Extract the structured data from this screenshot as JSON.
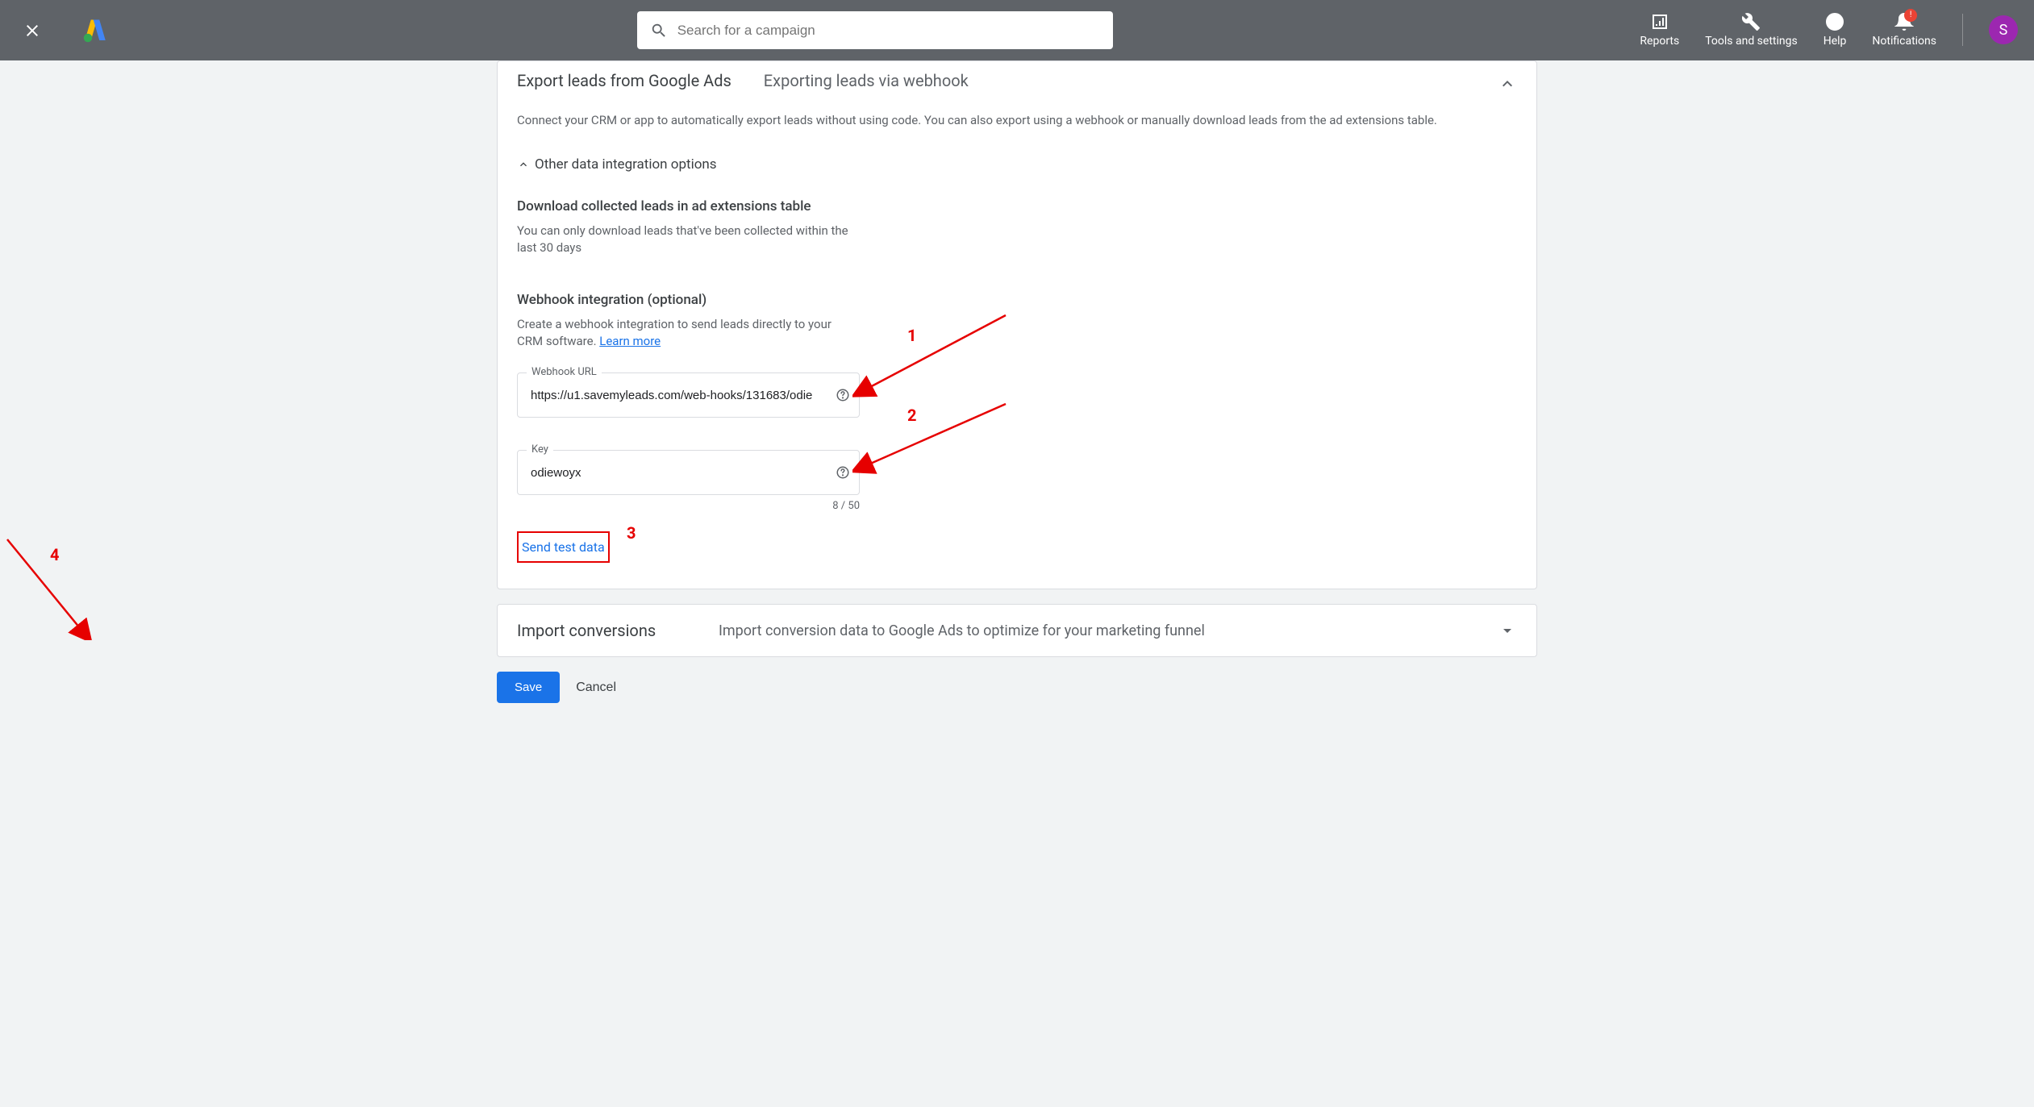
{
  "header": {
    "search_placeholder": "Search for a campaign",
    "reports_label": "Reports",
    "tools_label": "Tools and settings",
    "help_label": "Help",
    "notifications_label": "Notifications",
    "avatar_initial": "S",
    "notification_badge": "!"
  },
  "card1": {
    "breadcrumb": "Export leads from Google Ads",
    "title": "Exporting leads via webhook",
    "description": "Connect your CRM or app to automatically export leads without using code. You can also export using a webhook or manually download leads from the ad extensions table.",
    "other_options_label": "Other data integration options",
    "download_section_title": "Download collected leads in ad extensions table",
    "download_section_desc": "You can only download leads that've been collected within the last 30 days",
    "webhook_section_title": "Webhook integration (optional)",
    "webhook_section_desc": "Create a webhook integration to send leads directly to your CRM software. ",
    "learn_more_label": "Learn more",
    "webhook_url_label": "Webhook URL",
    "webhook_url_value": "https://u1.savemyleads.com/web-hooks/131683/odie",
    "key_label": "Key",
    "key_value": "odiewoyx",
    "key_counter": "8 / 50",
    "send_test_label": "Send test data"
  },
  "card2": {
    "title": "Import conversions",
    "description": "Import conversion data to Google Ads to optimize for your marketing funnel"
  },
  "buttons": {
    "save_label": "Save",
    "cancel_label": "Cancel"
  },
  "annotations": {
    "n1": "1",
    "n2": "2",
    "n3": "3",
    "n4": "4"
  }
}
